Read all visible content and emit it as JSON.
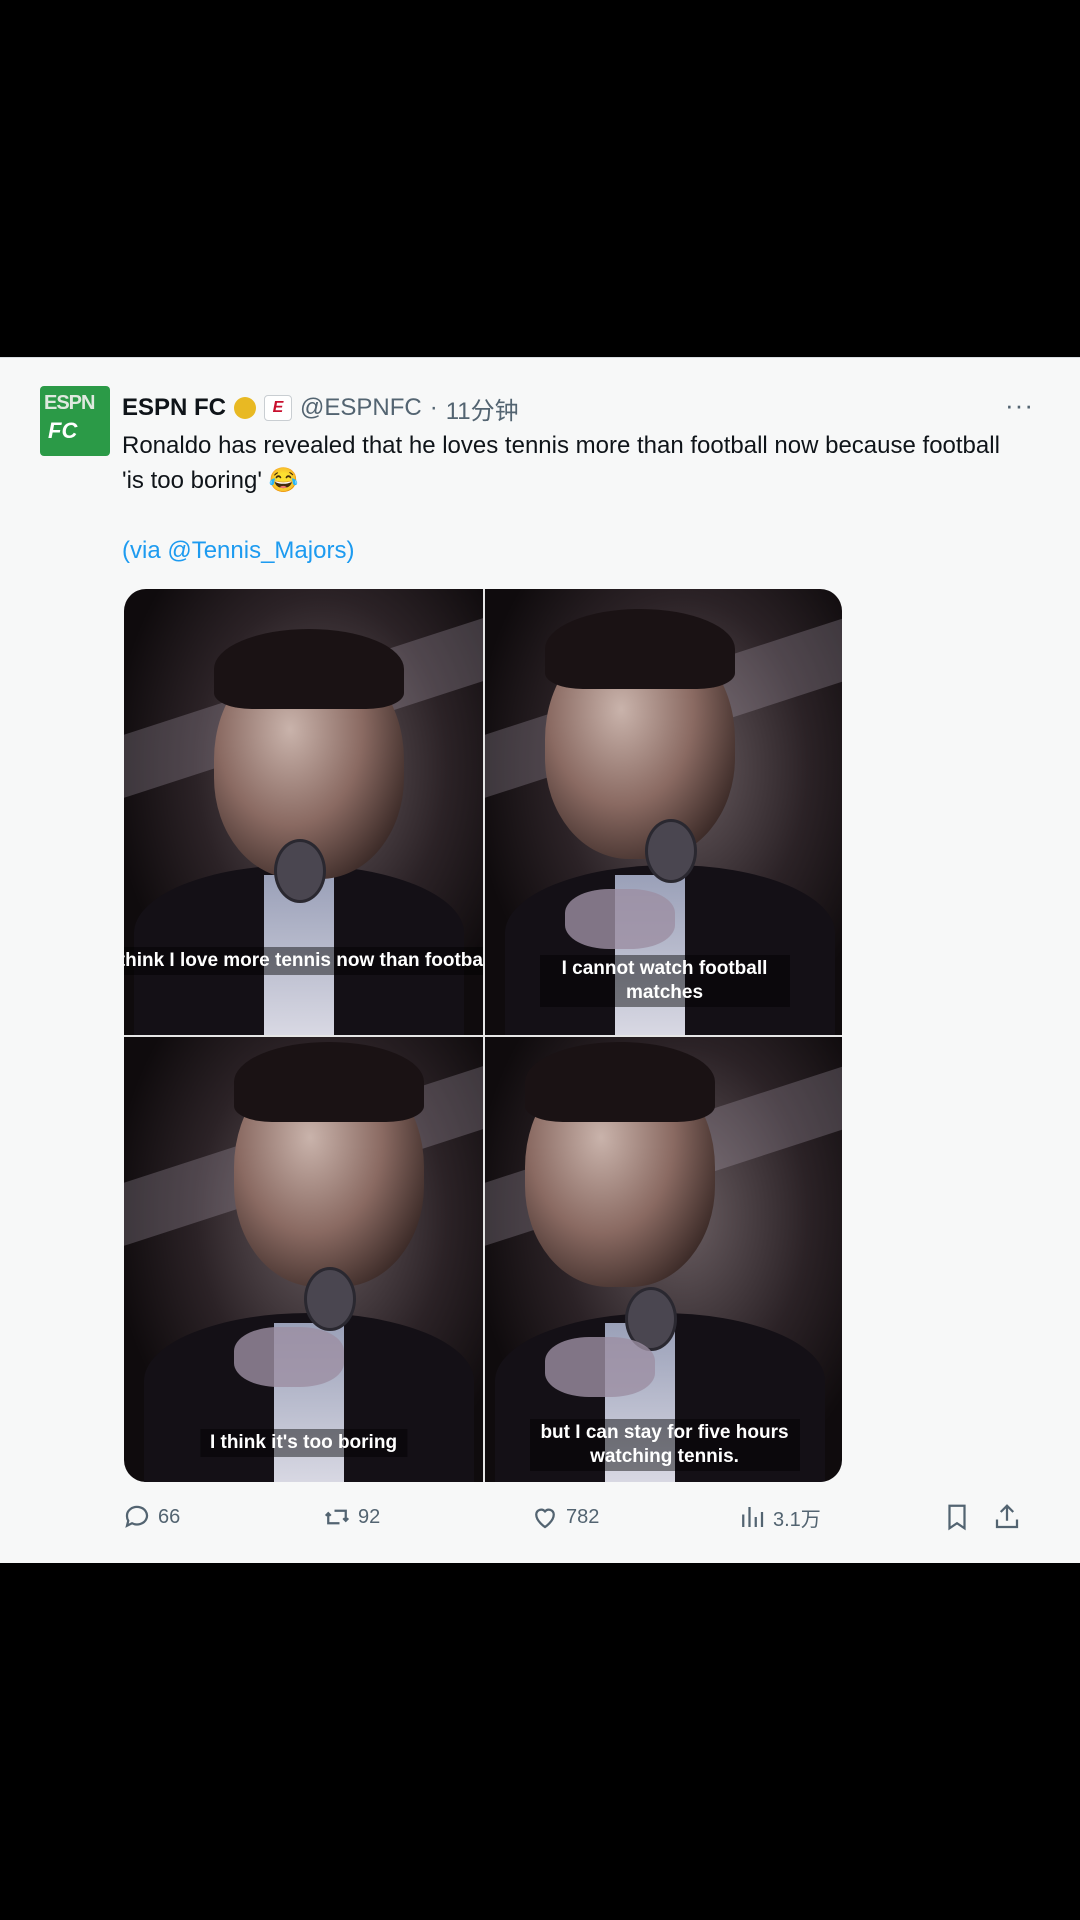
{
  "tweet": {
    "display_name": "ESPN FC",
    "badge_letter": "E",
    "handle": "@ESPNFC",
    "separator": "·",
    "time": "11分钟",
    "more": "···",
    "avatar_text_top": "ESPN",
    "avatar_text_bottom": "FC",
    "text_line": "Ronaldo has revealed that he loves tennis more than football now because football 'is too boring' 😂",
    "via": "(via @Tennis_Majors)"
  },
  "media": {
    "captions": [
      "I think I love more tennis now than football.",
      "I cannot watch football matches",
      "I think it's too boring",
      "but I can stay for five hours watching tennis."
    ]
  },
  "actions": {
    "replies": "66",
    "reposts": "92",
    "likes": "782",
    "views": "3.1万"
  },
  "colors": {
    "background": "#000000",
    "card": "#f7f8f8",
    "link": "#1d9bf0",
    "avatar": "#2b9a47",
    "muted": "#536471"
  },
  "icons": [
    "reply-icon",
    "repost-icon",
    "like-icon",
    "views-icon",
    "bookmark-icon",
    "share-icon",
    "verified-icon",
    "more-icon"
  ]
}
